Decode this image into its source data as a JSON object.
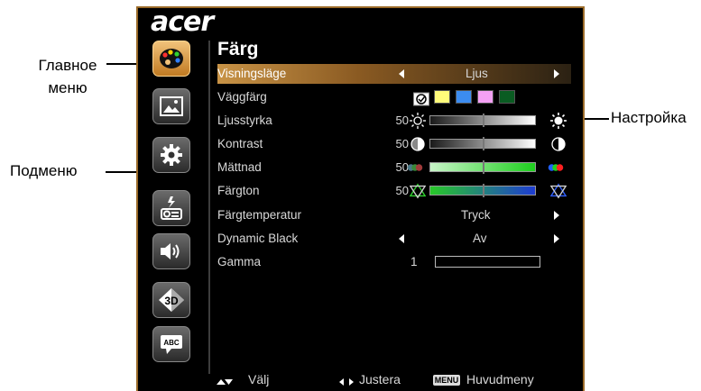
{
  "annotations": {
    "main_menu": "Главное\nменю",
    "main_menu_line1": "Главное",
    "main_menu_line2": "меню",
    "submenu": "Подменю",
    "setting": "Настройка"
  },
  "brand": "acer",
  "menu": {
    "title": "Färg",
    "icons": [
      "palette-icon",
      "image-icon",
      "gear-icon",
      "projector-icon",
      "speaker-icon",
      "3d-icon",
      "abc-icon"
    ],
    "rows": {
      "visningslage": {
        "label": "Visningsläge",
        "value": "Ljus"
      },
      "vaggfarg": {
        "label": "Väggfärg"
      },
      "ljusstyrka": {
        "label": "Ljusstyrka",
        "value": "50"
      },
      "kontrast": {
        "label": "Kontrast",
        "value": "50"
      },
      "mattnad": {
        "label": "Mättnad",
        "value": "50"
      },
      "fargton": {
        "label": "Färgton",
        "value": "50"
      },
      "fargtemperatur": {
        "label": "Färgtemperatur",
        "value": "Tryck"
      },
      "dynamic_black": {
        "label": "Dynamic Black",
        "value": "Av"
      },
      "gamma": {
        "label": "Gamma",
        "value": "1"
      }
    },
    "swatch_colors": [
      "#fffb7a",
      "#3c8cf0",
      "#f4a0f4",
      "#0a5c22"
    ],
    "bar_gradients": {
      "ljusstyrka": [
        "#1a1a1a",
        "#ffffff"
      ],
      "kontrast": [
        "#1a1a1a",
        "#ffffff"
      ],
      "mattnad": [
        "#c8f5c8",
        "#1ecf1e"
      ],
      "fargton": [
        "#28c828",
        "#1e3cd2"
      ]
    }
  },
  "footer": {
    "select": "Välj",
    "adjust": "Justera",
    "menu_key": "MENU",
    "main_menu": "Huvudmeny"
  }
}
